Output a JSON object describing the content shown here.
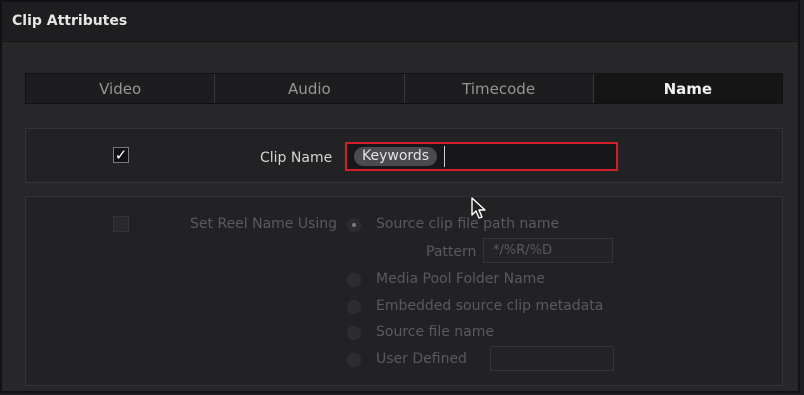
{
  "window": {
    "title": "Clip Attributes"
  },
  "tabs": [
    {
      "label": "Video",
      "active": false
    },
    {
      "label": "Audio",
      "active": false
    },
    {
      "label": "Timecode",
      "active": false
    },
    {
      "label": "Name",
      "active": true
    }
  ],
  "clip_name": {
    "checkbox_mark": "✓",
    "label": "Clip Name",
    "keyword_token": "Keywords"
  },
  "reel_name": {
    "checkbox_mark": "",
    "label": "Set Reel Name Using",
    "options": [
      "Source clip file path name",
      "Media Pool Folder Name",
      "Embedded source clip metadata",
      "Source file name",
      "User Defined"
    ],
    "selected_option": "Source clip file path name",
    "pattern_label": "Pattern",
    "pattern_value": "*/%R/%D",
    "user_defined_value": ""
  },
  "colors": {
    "active_border": "#d11f28",
    "background": "#27272a",
    "tab_active": "#151516"
  }
}
